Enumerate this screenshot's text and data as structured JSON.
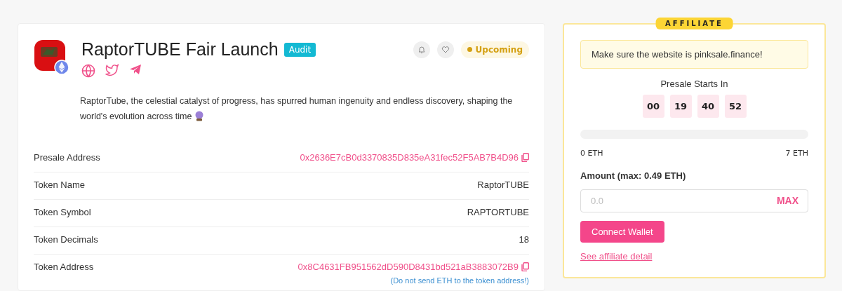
{
  "project": {
    "title": "RaptorTUBE Fair Launch",
    "badge": "Audit",
    "status": {
      "label": "Upcoming",
      "color": "#d4a012"
    },
    "description": "RaptorTube, the celestial catalyst of progress, has spurred human ingenuity and endless discovery, shaping the world's evolution across time"
  },
  "details": [
    {
      "label": "Presale Address",
      "value": "0x2636E7cB0d3370835D835eA31fec52F5AB7B4D96",
      "kind": "address"
    },
    {
      "label": "Token Name",
      "value": "RaptorTUBE",
      "kind": "plain"
    },
    {
      "label": "Token Symbol",
      "value": "RAPTORTUBE",
      "kind": "plain"
    },
    {
      "label": "Token Decimals",
      "value": "18",
      "kind": "plain"
    },
    {
      "label": "Token Address",
      "value": "0x8C4631FB951562dD590D8431bd521aB3883072B9",
      "kind": "address",
      "note": "(Do not send ETH to the token address!)"
    }
  ],
  "affiliate": {
    "tag": "AFFILIATE",
    "warning": "Make sure the website is pinksale.finance!",
    "countdown_title": "Presale Starts In",
    "countdown": [
      "00",
      "19",
      "40",
      "52"
    ],
    "progress": {
      "level": 0,
      "min_label": "0 ETH",
      "max_label": "7 ETH"
    },
    "amount_label": "Amount (max: 0.49 ETH)",
    "amount_placeholder": "0.0",
    "max_button": "MAX",
    "connect_button": "Connect Wallet",
    "detail_link": "See affiliate detail"
  }
}
